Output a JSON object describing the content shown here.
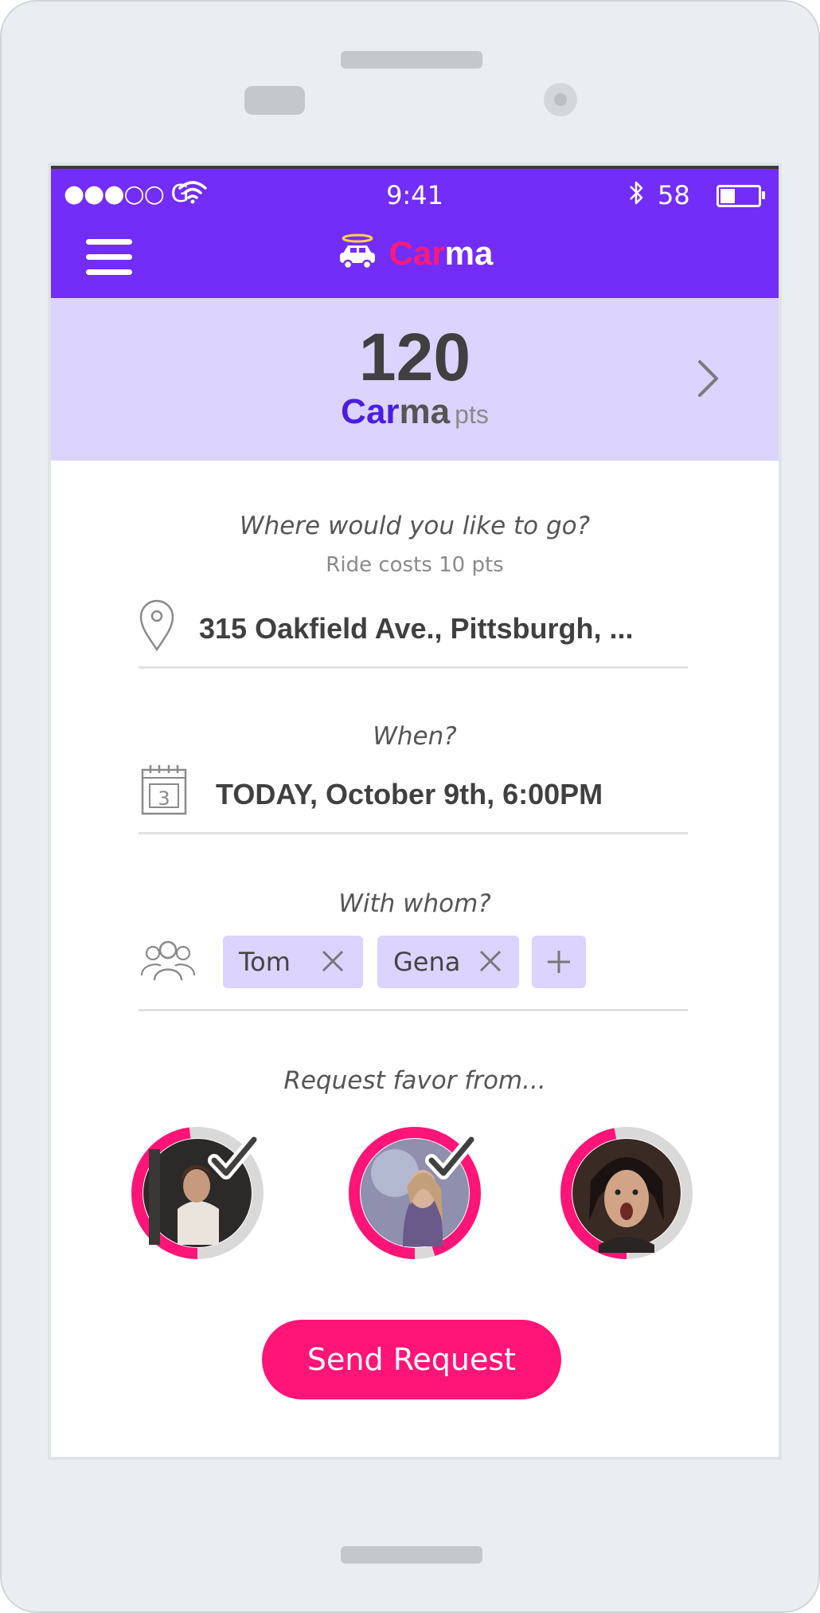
{
  "status_bar": {
    "carrier": "●●●○○ G",
    "time": "9:41",
    "battery_percent": "58",
    "battery_level": 0.4
  },
  "nav": {
    "logo_car": "Car",
    "logo_ma": "ma",
    "icons": {
      "menu": "hamburger-menu-icon",
      "logo": "car-halo-icon"
    }
  },
  "points": {
    "value": "120",
    "brand_car": "Car",
    "brand_ma": "ma",
    "unit": "pts"
  },
  "destination": {
    "prompt": "Where would you like to go?",
    "cost_note": "Ride costs 10 pts",
    "value": "315 Oakfield Ave., Pittsburgh, ..."
  },
  "when": {
    "prompt": "When?",
    "calendar_day": "3",
    "value": "TODAY, October 9th, 6:00PM"
  },
  "companions": {
    "prompt": "With whom?",
    "people": [
      "Tom",
      "Gena"
    ]
  },
  "favor": {
    "prompt": "Request favor from...",
    "contacts": [
      {
        "selected": true,
        "progress": 0.48
      },
      {
        "selected": true,
        "progress": 0.95
      },
      {
        "selected": false,
        "progress": 0.47
      }
    ]
  },
  "actions": {
    "send_label": "Send Request"
  },
  "colors": {
    "brand_purple": "#732df8",
    "accent_pink": "#ff1478",
    "light_lavender": "#dcd3fe"
  }
}
